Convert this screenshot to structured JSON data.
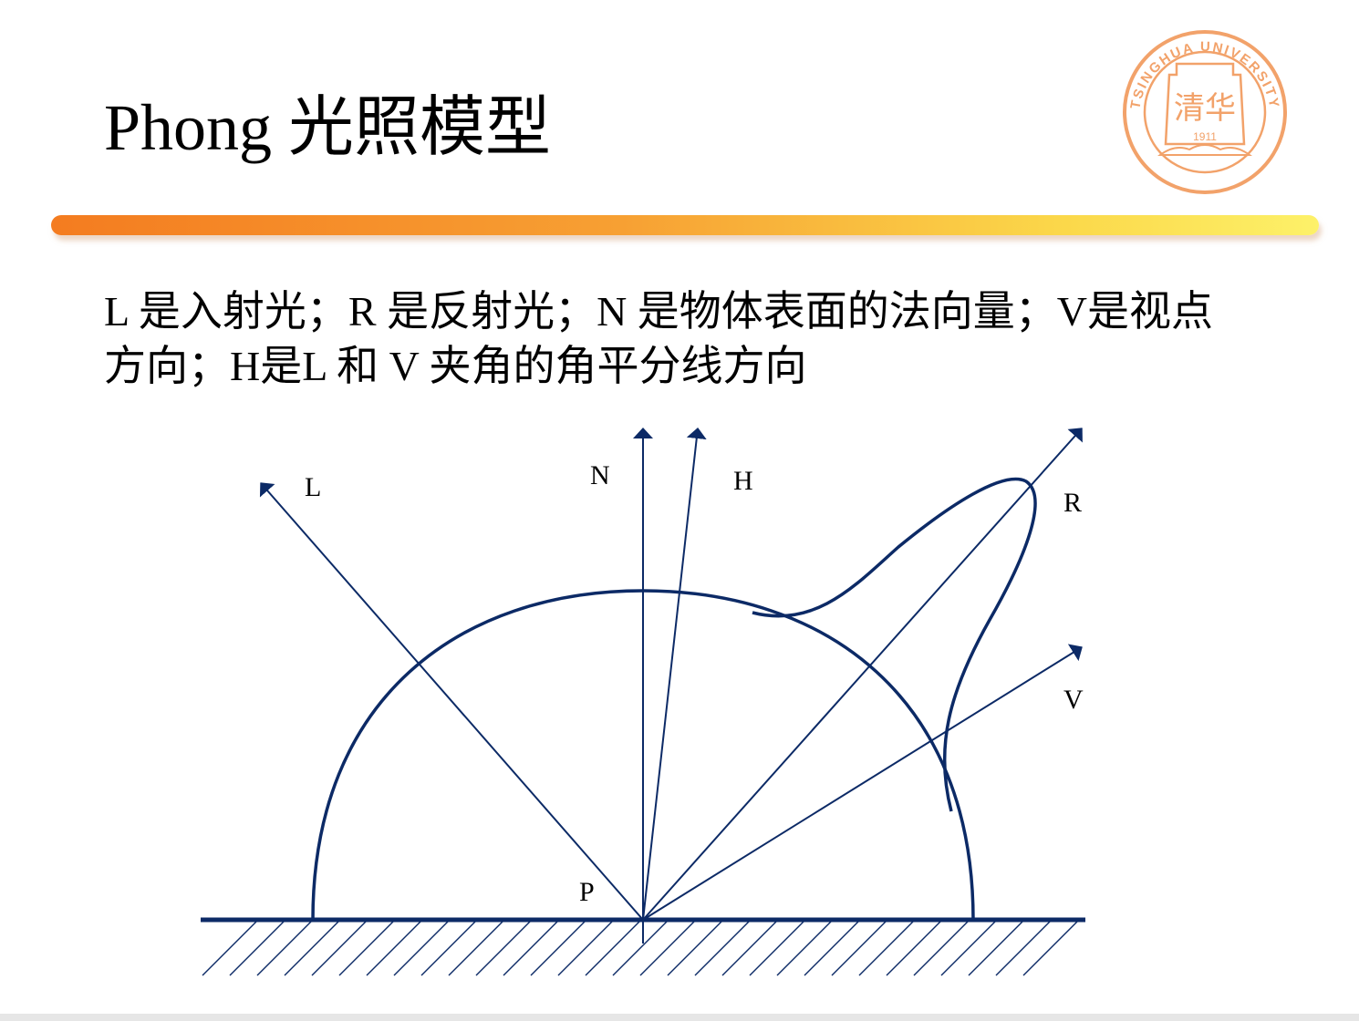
{
  "slide": {
    "title": "Phong 光照模型",
    "description": "L 是入射光；R 是反射光；N 是物体表面的法向量；V是视点方向；H是L 和 V 夹角的角平分线方向"
  },
  "colors": {
    "diagram_stroke": "#0c2a66",
    "accent_orange": "#f47c20",
    "accent_yellow": "#fdf169",
    "seal": "#f2a26a"
  },
  "seal": {
    "ring_text": "TSINGHUA UNIVERSITY",
    "year": "1911",
    "center_glyphs": "清华"
  },
  "diagram": {
    "labels": {
      "L": "L",
      "N": "N",
      "H": "H",
      "R": "R",
      "V": "V",
      "P": "P"
    }
  }
}
